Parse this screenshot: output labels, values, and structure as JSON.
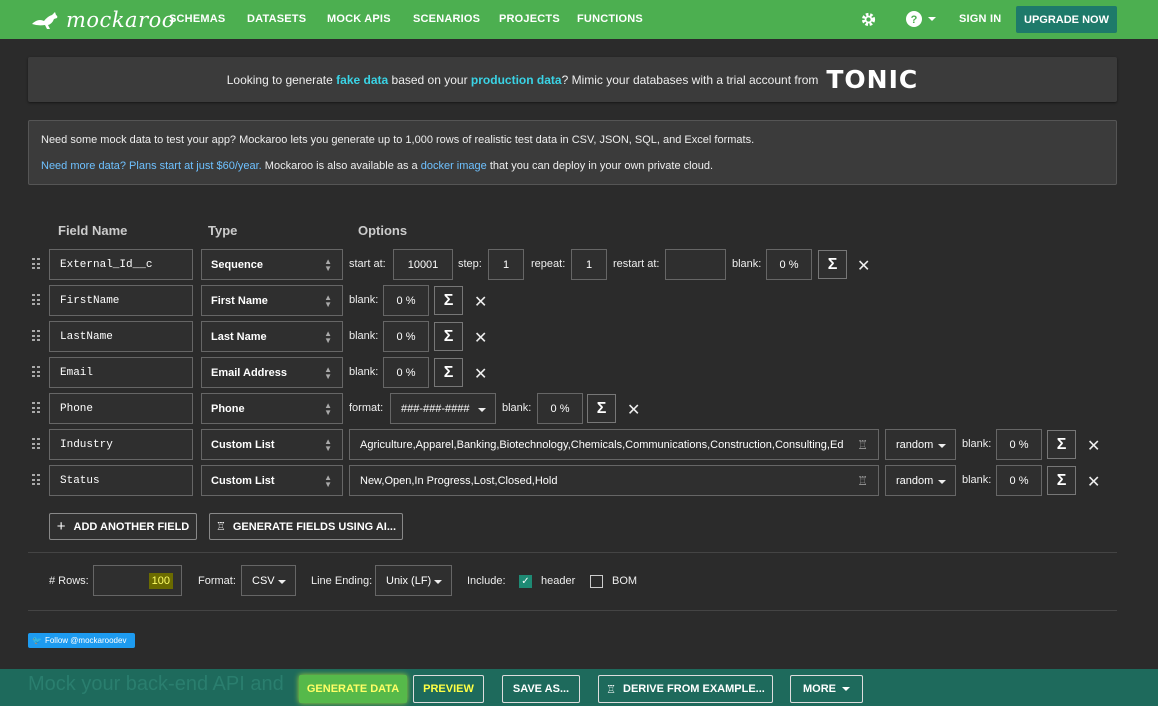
{
  "nav": {
    "logo": "mockaroo",
    "links": [
      "SCHEMAS",
      "DATASETS",
      "MOCK APIS",
      "SCENARIOS",
      "PROJECTS",
      "FUNCTIONS"
    ],
    "sign_in": "SIGN IN",
    "upgrade": "UPGRADE NOW",
    "settings_icon": "gear-icon",
    "help_icon": "help-icon"
  },
  "tonic_banner": {
    "t1": "Looking to generate ",
    "h1": "fake data",
    "t2": " based on your ",
    "h2": "production data",
    "t3": "? Mimic your databases with a trial account from",
    "logo": "TONIC",
    "highlight_color": "#3ad3e5"
  },
  "info": {
    "line1": "Need some mock data to test your app? Mockaroo lets you generate up to 1,000 rows of realistic test data in CSV, JSON, SQL, and Excel formats.",
    "link1": "Need more data? Plans start at just $60/year.",
    "t2": " Mockaroo is also available as a ",
    "link2": "docker image",
    "t3": " that you can deploy in your own private cloud."
  },
  "columns": {
    "field_name": "Field Name",
    "type": "Type",
    "options": "Options"
  },
  "rows": [
    {
      "name": "External_Id__c",
      "type": "Sequence",
      "start_label": "start at:",
      "start": "10001",
      "step_label": "step:",
      "step": "1",
      "repeat_label": "repeat:",
      "repeat": "1",
      "restart_label": "restart at:",
      "restart": "",
      "blank_label": "blank:",
      "blank": "0 %"
    },
    {
      "name": "FirstName",
      "type": "First Name",
      "blank_label": "blank:",
      "blank": "0 %"
    },
    {
      "name": "LastName",
      "type": "Last Name",
      "blank_label": "blank:",
      "blank": "0 %"
    },
    {
      "name": "Email",
      "type": "Email Address",
      "blank_label": "blank:",
      "blank": "0 %"
    },
    {
      "name": "Phone",
      "type": "Phone",
      "format_label": "format:",
      "format": "###-###-####",
      "blank_label": "blank:",
      "blank": "0 %"
    },
    {
      "name": "Industry",
      "type": "Custom List",
      "values": "Agriculture,Apparel,Banking,Biotechnology,Chemicals,Communications,Construction,Consulting,Education",
      "order": "random",
      "blank_label": "blank:",
      "blank": "0 %"
    },
    {
      "name": "Status",
      "type": "Custom List",
      "values": "New,Open,In Progress,Lost,Closed,Hold",
      "order": "random",
      "blank_label": "blank:",
      "blank": "0 %"
    }
  ],
  "actions": {
    "add_field": "ADD ANOTHER FIELD",
    "generate_ai": "GENERATE FIELDS USING AI..."
  },
  "settings": {
    "rows_label": "# Rows:",
    "rows": "100",
    "format_label": "Format:",
    "format": "CSV",
    "line_ending_label": "Line Ending:",
    "line_ending": "Unix (LF)",
    "include_label": "Include:",
    "header": "header",
    "header_checked": true,
    "bom": "BOM",
    "bom_checked": false
  },
  "twitter": "Follow @mockaroodev",
  "footer": {
    "ghost_text": "Mock your back-end API and",
    "generate": "GENERATE DATA",
    "preview": "PREVIEW",
    "save": "SAVE AS...",
    "derive": "DERIVE FROM EXAMPLE...",
    "more": "MORE"
  },
  "colors": {
    "nav": "#4caf50",
    "accent": "#1e7a6a",
    "footer": "#1e6a5c",
    "highlight": "#ffff00"
  }
}
